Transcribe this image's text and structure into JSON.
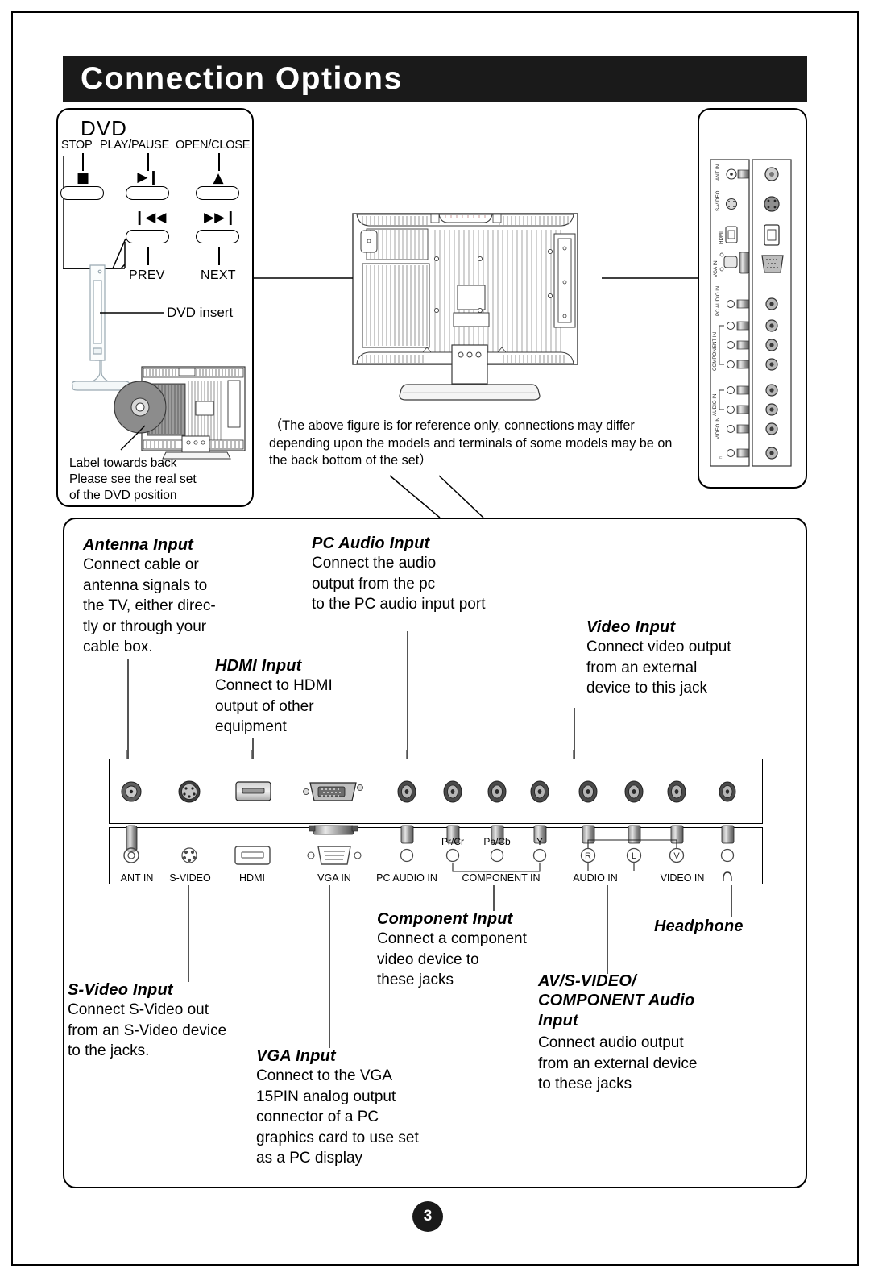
{
  "page": {
    "title": "Connection Options",
    "number": "3"
  },
  "dvd_panel": {
    "heading": "DVD",
    "button_labels": {
      "stop": "STOP",
      "play_pause": "PLAY/PAUSE",
      "open_close": "OPEN/CLOSE",
      "prev": "PREV",
      "next": "NEXT"
    },
    "glyphs": {
      "stop": "■",
      "play_pause": "▶❙",
      "open_close": "▲",
      "prev": "❙◀◀",
      "next": "▶▶❙"
    },
    "dvd_insert_label": "DVD insert",
    "disc_note": "Label towards back\nPlease see the real set\nof the DVD position"
  },
  "reference_note": "（The above figure is for reference only, connections may differ depending upon the models and terminals of some models may be on the back bottom of the set）",
  "side_ports_panel": {
    "labels": [
      "ANT IN",
      "S-VIDEO",
      "HDMI",
      "VGA IN",
      "PC AUDIO IN",
      "COMPONENT IN",
      "AUDIO IN",
      "VIDEO IN",
      "headphone"
    ]
  },
  "connector_panel": {
    "labels": [
      "ANT IN",
      "S-VIDEO",
      "HDMI",
      "VGA IN",
      "PC AUDIO IN",
      "COMPONENT IN",
      "AUDIO IN",
      "VIDEO IN"
    ],
    "component_pins": [
      "Pr/Cr",
      "Pb/Cb",
      "Y"
    ],
    "av_pins": [
      "R",
      "L",
      "V"
    ],
    "headphone_glyph": "∩"
  },
  "descriptions": {
    "antenna": {
      "heading": "Antenna Input",
      "body": "Connect cable or\nantenna signals to\nthe TV, either direc-\ntly or through your\ncable box."
    },
    "pc_audio": {
      "heading": "PC Audio Input",
      "body": "Connect the audio\noutput from the pc\nto the PC audio input port"
    },
    "hdmi": {
      "heading": "HDMI Input",
      "body": "Connect to HDMI\noutput of other\nequipment"
    },
    "video": {
      "heading": "Video Input",
      "body": "Connect video output\nfrom an external\ndevice to this jack"
    },
    "component": {
      "heading": "Component Input",
      "body": "Connect a component\nvideo device to\nthese jacks"
    },
    "headphone": {
      "heading": "Headphone",
      "body": ""
    },
    "av_svideo_component_audio": {
      "heading": "AV/S-VIDEO/\nCOMPONENT Audio\nInput",
      "body": "Connect audio output\nfrom an external device\nto these jacks"
    },
    "svideo": {
      "heading": "S-Video Input",
      "body": "Connect S-Video out\nfrom an S-Video device\nto the jacks."
    },
    "vga": {
      "heading": "VGA  Input",
      "body": "Connect to the VGA\n15PIN analog output\nconnector of a PC\ngraphics card to use set\nas a PC display"
    }
  },
  "colors": {
    "banner_bg": "#1a1a1a",
    "banner_text": "#ffffff",
    "line": "#000000",
    "metal_dark": "#5a5a5a",
    "metal_light": "#d8d8d8"
  }
}
